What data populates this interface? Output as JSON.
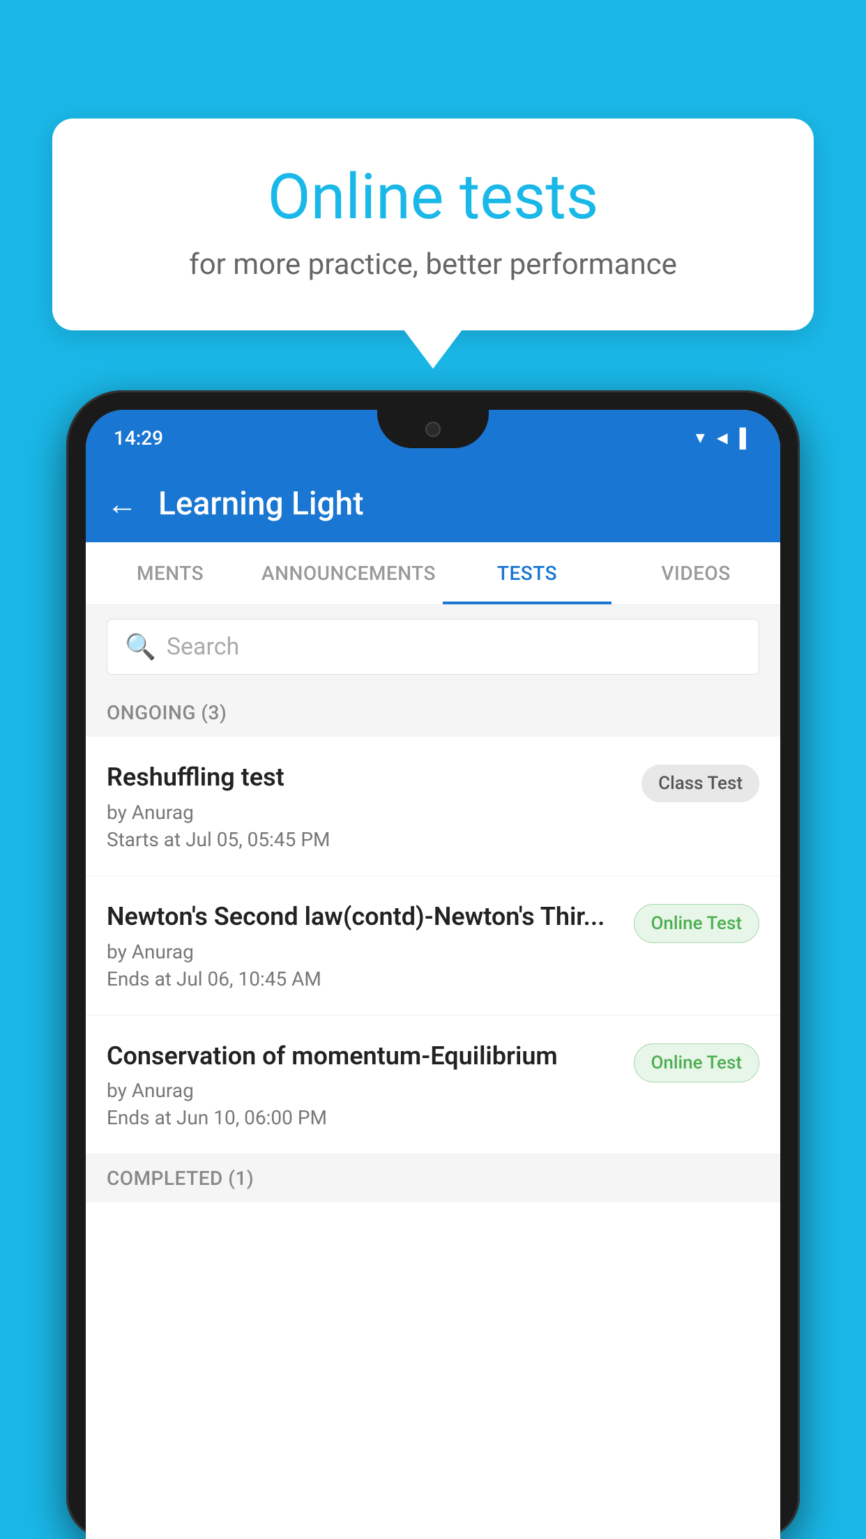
{
  "background_color": "#1ab8e8",
  "speech_bubble": {
    "title": "Online tests",
    "subtitle": "for more practice, better performance"
  },
  "phone": {
    "status_bar": {
      "time": "14:29",
      "icons": "▼◄▌"
    },
    "header": {
      "title": "Learning Light",
      "back_label": "←"
    },
    "tabs": [
      {
        "label": "MENTS",
        "active": false
      },
      {
        "label": "ANNOUNCEMENTS",
        "active": false
      },
      {
        "label": "TESTS",
        "active": true
      },
      {
        "label": "VIDEOS",
        "active": false
      }
    ],
    "search": {
      "placeholder": "Search",
      "search_icon": "🔍"
    },
    "sections": [
      {
        "title": "ONGOING (3)",
        "tests": [
          {
            "name": "Reshuffling test",
            "author": "by Anurag",
            "time_label": "Starts at",
            "time": "Jul 05, 05:45 PM",
            "badge": "Class Test",
            "badge_type": "class"
          },
          {
            "name": "Newton's Second law(contd)-Newton's Thir...",
            "author": "by Anurag",
            "time_label": "Ends at",
            "time": "Jul 06, 10:45 AM",
            "badge": "Online Test",
            "badge_type": "online"
          },
          {
            "name": "Conservation of momentum-Equilibrium",
            "author": "by Anurag",
            "time_label": "Ends at",
            "time": "Jun 10, 06:00 PM",
            "badge": "Online Test",
            "badge_type": "online"
          }
        ]
      },
      {
        "title": "COMPLETED (1)",
        "tests": []
      }
    ]
  }
}
